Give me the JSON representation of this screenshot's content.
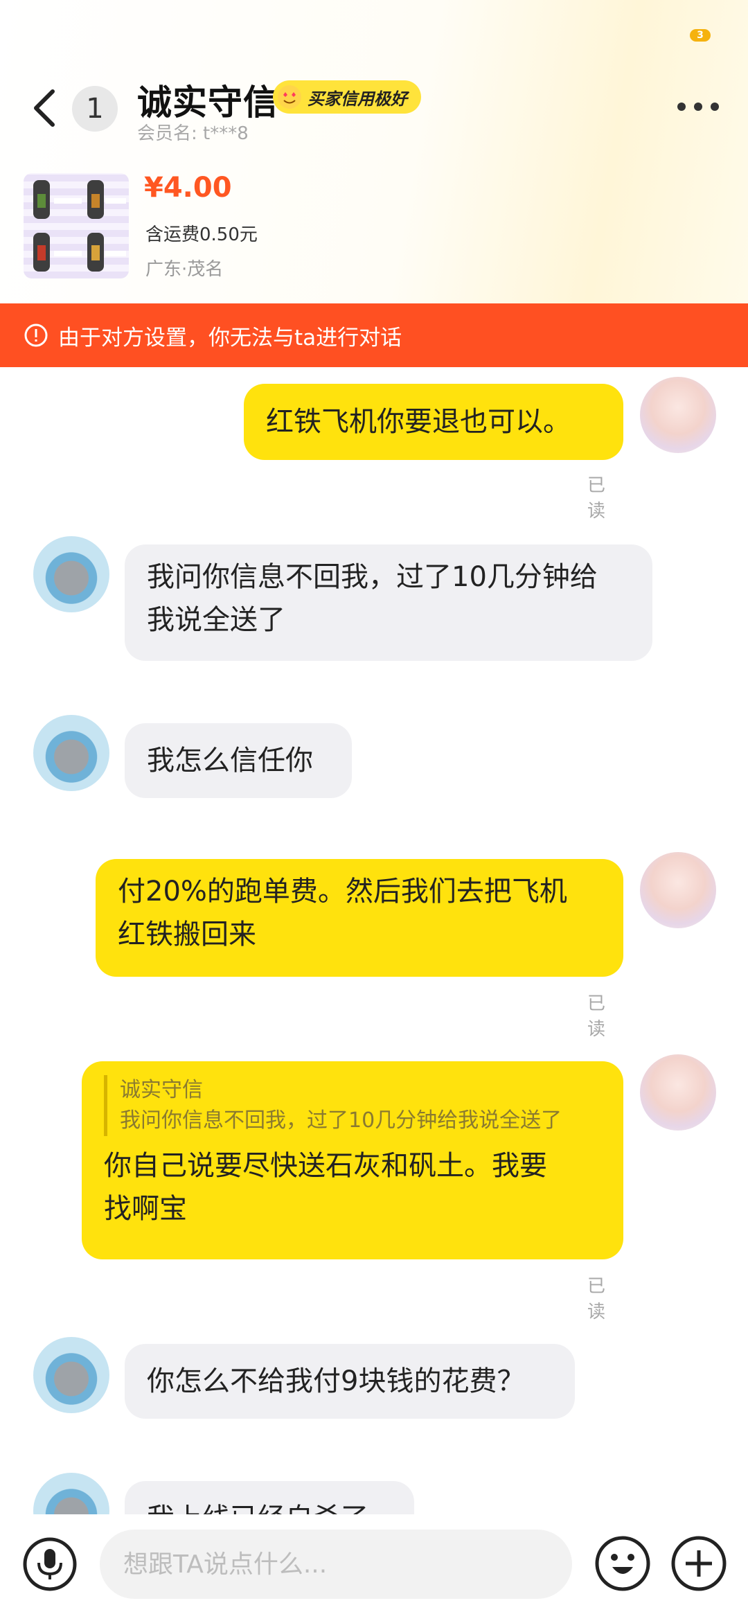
{
  "header": {
    "status_badge": "3",
    "unread_count": "1",
    "name": "诚实守信",
    "credit_badge": "买家信用极好",
    "member_line": "会员名: t***8"
  },
  "product": {
    "price": "¥4.00",
    "shipping": "含运费0.50元",
    "location": "广东·茂名"
  },
  "banner": {
    "text": "由于对方设置，你无法与ta进行对话"
  },
  "messages": [
    {
      "side": "mine",
      "text": "红铁飞机你要退也可以。",
      "read": "已读"
    },
    {
      "side": "other",
      "text_lines": [
        "我问你信息不回我，过了10几分钟给",
        "我说全送了"
      ]
    },
    {
      "side": "other",
      "text": "我怎么信任你"
    },
    {
      "side": "mine",
      "text_lines": [
        "付20%的跑单费。然后我们去把飞机",
        "红铁搬回来"
      ],
      "read": "已读"
    },
    {
      "side": "mine",
      "quote_name": "诚实守信",
      "quote_text": "我问你信息不回我，过了10几分钟给我说全送了",
      "text_lines": [
        "你自己说要尽快送石灰和矾土。我要",
        "找啊宝"
      ],
      "read": "已读"
    },
    {
      "side": "other",
      "text": "你怎么不给我付9块钱的花费？"
    },
    {
      "side": "other",
      "text": "我上线已经自杀了"
    }
  ],
  "input": {
    "placeholder": "想跟TA说点什么..."
  },
  "colors": {
    "accent_yellow": "#ffe20d",
    "banner_orange": "#ff5022",
    "price_orange": "#ff5722"
  },
  "icons": [
    "back-arrow-icon",
    "more-icon",
    "alert-circle-icon",
    "microphone-icon",
    "emoji-icon",
    "plus-icon"
  ]
}
